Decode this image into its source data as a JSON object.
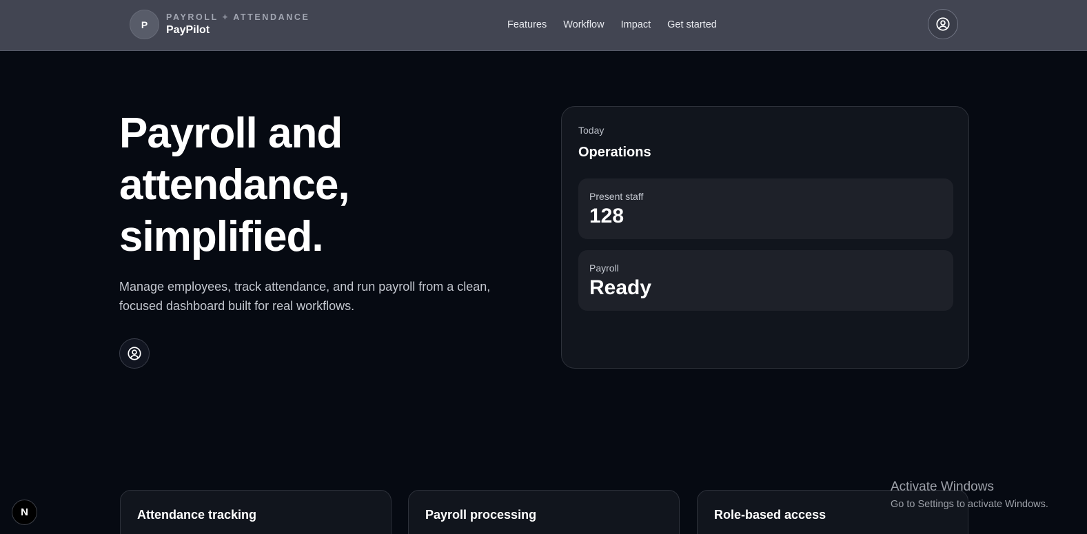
{
  "header": {
    "brand": {
      "logo_letter": "P",
      "eyebrow": "PAYROLL + ATTENDANCE",
      "name": "PayPilot"
    },
    "nav": [
      "Features",
      "Workflow",
      "Impact",
      "Get started"
    ],
    "account_icon": "user-circle-icon"
  },
  "hero": {
    "title_lines": [
      "Payroll and",
      "attendance,",
      "simplified."
    ],
    "subtitle": "Manage employees, track attendance, and run payroll from a clean, focused dashboard built for real workflows.",
    "account_icon": "user-circle-icon"
  },
  "operations": {
    "eyebrow": "Today",
    "title": "Operations",
    "stats": [
      {
        "label": "Present staff",
        "value": "128"
      },
      {
        "label": "Payroll",
        "value": "Ready"
      }
    ]
  },
  "features": [
    {
      "title": "Attendance tracking"
    },
    {
      "title": "Payroll processing"
    },
    {
      "title": "Role-based access"
    }
  ],
  "dev_badge": {
    "letter": "N"
  },
  "watermark": {
    "title": "Activate Windows",
    "subtitle": "Go to Settings to activate Windows."
  },
  "colors": {
    "background": "#060a12",
    "header": "#424552",
    "card": "#11151d",
    "stat_card": "#1e2129"
  }
}
